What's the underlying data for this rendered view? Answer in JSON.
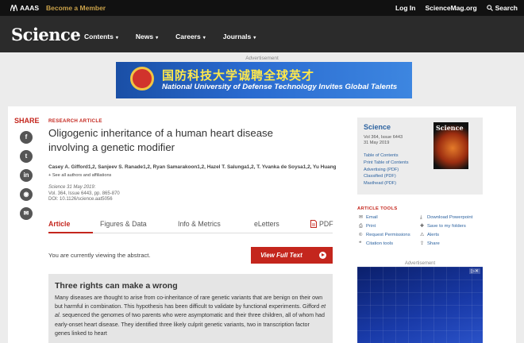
{
  "topbar": {
    "aaas": "AAAS",
    "member": "Become a Member",
    "login": "Log In",
    "site": "ScienceMag.org",
    "search": "Search"
  },
  "nav": {
    "logo": "Science",
    "items": [
      "Contents",
      "News",
      "Careers",
      "Journals"
    ]
  },
  "ad": {
    "label": "Advertisement",
    "cn_text": "国防科技大学诚聘全球英才",
    "en_text": "National University of Defense Technology Invites Global Talents"
  },
  "share": {
    "label": "SHARE",
    "icons": [
      "facebook-icon",
      "twitter-icon",
      "linkedin-icon",
      "reddit-icon",
      "email-icon"
    ]
  },
  "article": {
    "kicker": "RESEARCH ARTICLE",
    "title": "Oligogenic inheritance of a human heart disease involving a genetic modifier",
    "authors": "Casey A. Gifford1,2, Sanjeev S. Ranade1,2, Ryan Samarakoon1,2, Hazel T. Salunga1,2, T. Yvanka de Soysa1,2, Yu Huang1, Ping ...",
    "affil": "See all authors and affiliations",
    "pub_line1": "Science  31 May 2019:",
    "pub_line2": "Vol. 364, Issue 6443, pp. 865-870",
    "pub_line3": "DOI: 10.1126/science.aat5056",
    "tabs": [
      "Article",
      "Figures & Data",
      "Info & Metrics",
      "eLetters",
      "PDF"
    ],
    "viewing": "You are currently viewing the abstract.",
    "view_full": "View Full Text",
    "abstract_title": "Three rights can make a wrong",
    "abstract_p1": "Many diseases are thought to arise from co-inheritance of rare genetic variants that are benign on their own but harmful in combination. This hypothesis has been difficult to validate by functional experiments. Gifford",
    "abstract_em": "et al.",
    "abstract_p2": "sequenced the genomes of two parents who were asymptomatic and their three children, all of whom had early-onset heart disease. They identified three likely culprit genetic variants, two in transcription factor genes linked to heart"
  },
  "journal": {
    "name": "Science",
    "vol": "Vol 364, Issue 6443",
    "date": "31 May 2019",
    "links": [
      "Table of Contents",
      "Print Table of Contents",
      "Advertising (PDF)",
      "Classified (PDF)",
      "Masthead (PDF)"
    ],
    "cover_text": "Science"
  },
  "tools": {
    "label": "ARTICLE TOOLS",
    "left": [
      "Email",
      "Print",
      "Request Permissions",
      "Citation tools"
    ],
    "right": [
      "Download Powerpoint",
      "Save to my folders",
      "Alerts",
      "Share"
    ]
  },
  "ad2": {
    "label": "Advertisement"
  },
  "colors": {
    "accent": "#c4261d",
    "link": "#2d63a0",
    "topbar": "#111111",
    "nav": "#2b2b2b"
  }
}
